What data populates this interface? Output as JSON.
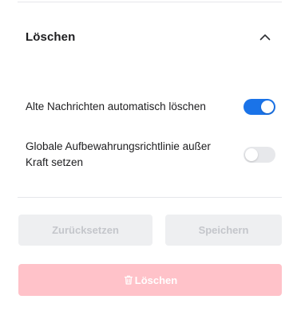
{
  "section": {
    "title": "Löschen",
    "expanded": true,
    "collapse_icon": "chevron-up-icon"
  },
  "settings": [
    {
      "label": "Alte Nachrichten automatisch löschen",
      "enabled": true
    },
    {
      "label": "Globale Aufbewahrungsrichtlinie außer Kraft setzen",
      "enabled": false
    }
  ],
  "buttons": {
    "reset_label": "Zurücksetzen",
    "save_label": "Speichern",
    "delete_label": "Löschen",
    "delete_icon": "trash-icon"
  },
  "colors": {
    "toggle_on": "#1a73e8",
    "toggle_off": "#e7e8eb",
    "delete_button": "#ffc2c9",
    "disabled_button": "#eeeff1"
  }
}
